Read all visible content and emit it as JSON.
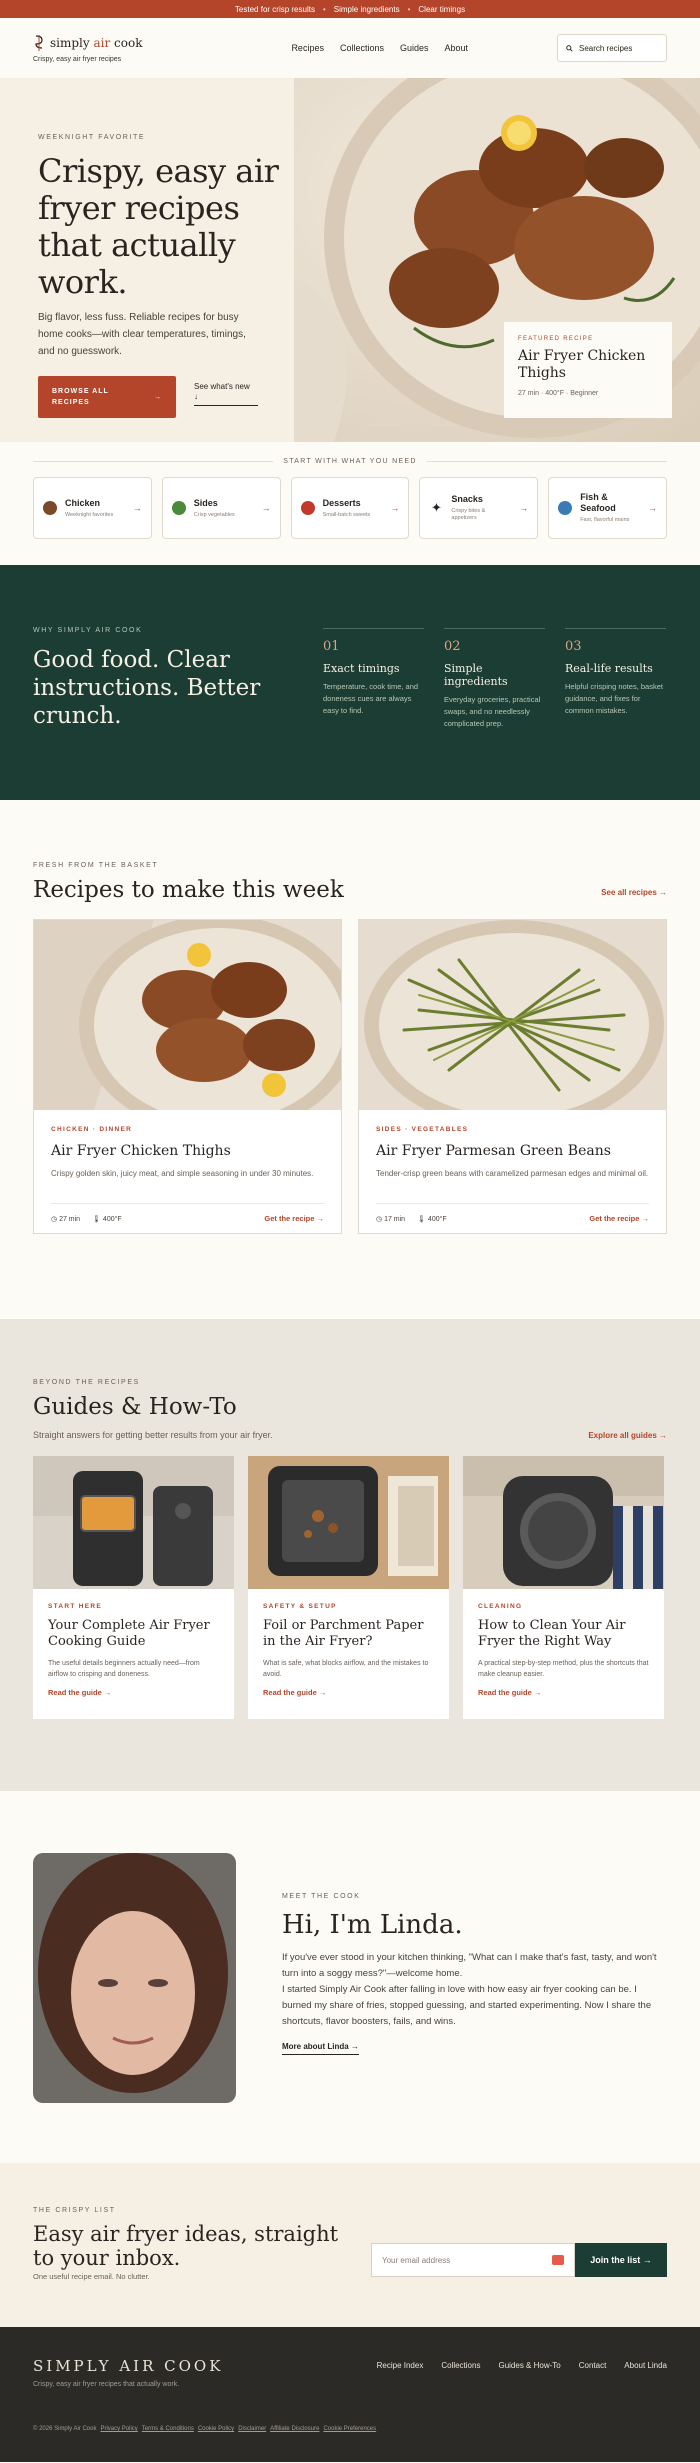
{
  "topbar": {
    "items": [
      "Tested for crisp results",
      "Simple ingredients",
      "Clear timings"
    ],
    "sep": "•"
  },
  "header": {
    "brand_pre": "simply ",
    "brand_accent": "air",
    "brand_post": " cook",
    "tagline": "Crispy, easy air fryer recipes",
    "nav": [
      "Recipes",
      "Collections",
      "Guides",
      "About"
    ],
    "search_label": "Search recipes"
  },
  "hero": {
    "eyebrow": "WEEKNIGHT FAVORITE",
    "title": "Crispy, easy air fryer recipes that actually work.",
    "desc": "Big flavor, less fuss. Reliable recipes for busy home cooks—with clear temperatures, timings, and no guesswork.",
    "cta": "BROWSE ALL RECIPES",
    "cta_arrow": "→",
    "link": "See what's new",
    "link_arrow": "↓",
    "feature": {
      "eyebrow": "FEATURED RECIPE",
      "title": "Air Fryer Chicken Thighs",
      "meta": "27 min · 400°F · Beginner"
    }
  },
  "start": {
    "heading": "START WITH WHAT YOU NEED",
    "cats": [
      {
        "name": "Chicken",
        "sub": "Weeknight favorites",
        "color": "#7a4a2a"
      },
      {
        "name": "Sides",
        "sub": "Crisp vegetables",
        "color": "#4a8a3a"
      },
      {
        "name": "Desserts",
        "sub": "Small-batch sweets",
        "color": "#c0392b"
      },
      {
        "name": "Snacks",
        "sub": "Crispy bites & appetizers",
        "color": "#2a2420"
      },
      {
        "name": "Fish & Seafood",
        "sub": "Fast, flavorful mains",
        "color": "#3a7ab5"
      }
    ],
    "arrow": "→"
  },
  "why": {
    "eyebrow": "WHY SIMPLY AIR COOK",
    "title": "Good food. Clear instructions. Better crunch.",
    "cols": [
      {
        "num": "01",
        "head": "Exact timings",
        "text": "Temperature, cook time, and doneness cues are always easy to find."
      },
      {
        "num": "02",
        "head": "Simple ingredients",
        "text": "Everyday groceries, practical swaps, and no needlessly complicated prep."
      },
      {
        "num": "03",
        "head": "Real-life results",
        "text": "Helpful crisping notes, basket guidance, and fixes for common mistakes."
      }
    ]
  },
  "recipes": {
    "eyebrow": "FRESH FROM THE BASKET",
    "title": "Recipes to make this week",
    "see_all": "See all recipes →",
    "cards": [
      {
        "cat": "CHICKEN · DINNER",
        "title": "Air Fryer Chicken Thighs",
        "desc": "Crispy golden skin, juicy meat, and simple seasoning in under 30 minutes.",
        "time": "27 min",
        "temp": "400°F",
        "link": "Get the recipe →"
      },
      {
        "cat": "SIDES · VEGETABLES",
        "title": "Air Fryer Parmesan Green Beans",
        "desc": "Tender-crisp green beans with caramelized parmesan edges and minimal oil.",
        "time": "17 min",
        "temp": "400°F",
        "link": "Get the recipe →"
      }
    ]
  },
  "guides": {
    "eyebrow": "BEYOND THE RECIPES",
    "title": "Guides & How-To",
    "sub": "Straight answers for getting better results from your air fryer.",
    "see_all": "Explore all guides →",
    "cards": [
      {
        "cat": "START HERE",
        "title": "Your Complete Air Fryer Cooking Guide",
        "desc": "The useful details beginners actually need—from airflow to crisping and doneness.",
        "link": "Read the guide →"
      },
      {
        "cat": "SAFETY & SETUP",
        "title": "Foil or Parchment Paper in the Air Fryer?",
        "desc": "What is safe, what blocks airflow, and the mistakes to avoid.",
        "link": "Read the guide →"
      },
      {
        "cat": "CLEANING",
        "title": "How to Clean Your Air Fryer the Right Way",
        "desc": "A practical step-by-step method, plus the shortcuts that make cleanup easier.",
        "link": "Read the guide →"
      }
    ]
  },
  "about": {
    "eyebrow": "MEET THE COOK",
    "title": "Hi, I'm Linda.",
    "p1": "If you've ever stood in your kitchen thinking, \"What can I make that's fast, tasty, and won't turn into a soggy mess?\"—welcome home.",
    "p2": "I started Simply Air Cook after falling in love with how easy air fryer cooking can be. I burned my share of fries, stopped guessing, and started experimenting. Now I share the shortcuts, flavor boosters, fails, and wins.",
    "link": "More about Linda →"
  },
  "news": {
    "eyebrow": "THE CRISPY LIST",
    "title": "Easy air fryer ideas, straight to your inbox.",
    "sub": "One useful recipe email. No clutter.",
    "placeholder": "Your email address",
    "button": "Join the list →"
  },
  "footer": {
    "brand": "SIMPLY AIR COOK",
    "tagline": "Crispy, easy air fryer recipes that actually work.",
    "nav": [
      "Recipe Index",
      "Collections",
      "Guides & How-To",
      "Contact",
      "About Linda"
    ],
    "copyright": "© 2026 Simply Air Cook",
    "legal": [
      "Privacy Policy",
      "Terms & Conditions",
      "Cookie Policy",
      "Disclaimer",
      "Affiliate Disclosure",
      "Cookie Preferences"
    ]
  }
}
